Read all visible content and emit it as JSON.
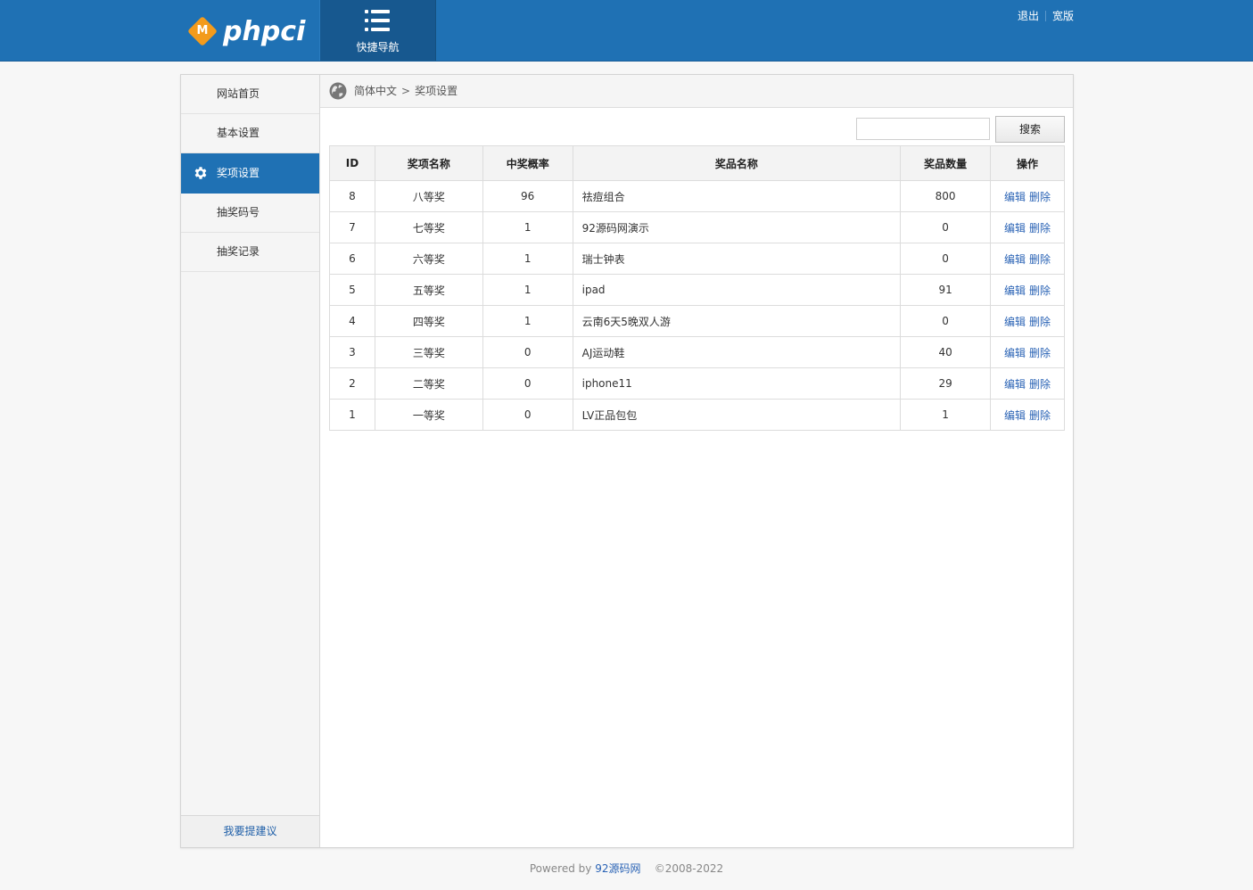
{
  "header": {
    "logo_badge": "M",
    "logo_text": "phpci",
    "quicknav_label": "快捷导航",
    "logout": "退出",
    "wide": "宽版"
  },
  "sidebar": {
    "items": [
      {
        "label": "网站首页"
      },
      {
        "label": "基本设置"
      },
      {
        "label": "奖项设置"
      },
      {
        "label": "抽奖码号"
      },
      {
        "label": "抽奖记录"
      }
    ],
    "active_index": 2,
    "footer_link": "我要提建议"
  },
  "breadcrumb": {
    "root": "简体中文",
    "separator": ">",
    "current": "奖项设置"
  },
  "search": {
    "value": "",
    "button": "搜索"
  },
  "table": {
    "headers": [
      "ID",
      "奖项名称",
      "中奖概率",
      "奖品名称",
      "奖品数量",
      "操作"
    ],
    "edit_label": "编辑",
    "delete_label": "删除",
    "rows": [
      {
        "id": "8",
        "name": "八等奖",
        "rate": "96",
        "prize": "祛痘组合",
        "qty": "800"
      },
      {
        "id": "7",
        "name": "七等奖",
        "rate": "1",
        "prize": "92源码网演示",
        "qty": "0"
      },
      {
        "id": "6",
        "name": "六等奖",
        "rate": "1",
        "prize": "瑞士钟表",
        "qty": "0"
      },
      {
        "id": "5",
        "name": "五等奖",
        "rate": "1",
        "prize": "ipad",
        "qty": "91"
      },
      {
        "id": "4",
        "name": "四等奖",
        "rate": "1",
        "prize": "云南6天5晚双人游",
        "qty": "0"
      },
      {
        "id": "3",
        "name": "三等奖",
        "rate": "0",
        "prize": "AJ运动鞋",
        "qty": "40"
      },
      {
        "id": "2",
        "name": "二等奖",
        "rate": "0",
        "prize": "iphone11",
        "qty": "29"
      },
      {
        "id": "1",
        "name": "一等奖",
        "rate": "0",
        "prize": "LV正品包包",
        "qty": "1"
      }
    ]
  },
  "footer": {
    "powered": "Powered by",
    "site": "92源码网",
    "copyright": "©2008-2022"
  },
  "colors": {
    "header_bg": "#1f71b4",
    "accent": "#1f71b4",
    "logo_orange": "#f39b1c",
    "link": "#2a63b5"
  },
  "icons": [
    "list-icon",
    "gear-icon",
    "globe-icon"
  ]
}
